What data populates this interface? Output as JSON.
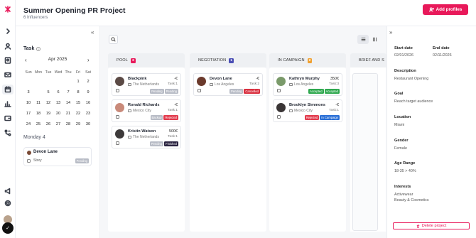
{
  "header": {
    "title": "Summer Opening PR Project",
    "subtitle": "6 Influencers",
    "add_profiles_label": "Add profiles"
  },
  "task_panel": {
    "title": "Task",
    "month_label": "Apr 2025",
    "weekdays": [
      "Sun",
      "Mon",
      "Tue",
      "Wed",
      "Thu",
      "Fri",
      "Sat"
    ],
    "weeks": [
      [
        "",
        "",
        "",
        "",
        "",
        "1",
        "2"
      ],
      [
        "3",
        "4",
        "5",
        "6",
        "7",
        "8",
        "9"
      ],
      [
        "10",
        "11",
        "12",
        "13",
        "14",
        "15",
        "16"
      ],
      [
        "17",
        "18",
        "19",
        "20",
        "21",
        "22",
        "23"
      ],
      [
        "24",
        "25",
        "26",
        "27",
        "28",
        "29",
        "30"
      ]
    ],
    "selected_day": "4",
    "day_title": "Monday 4",
    "day_task": {
      "name": "Devon Lane",
      "type": "Story",
      "status": "Pending"
    }
  },
  "board": {
    "columns": [
      {
        "title": "POOL",
        "count": "3",
        "count_color": "#e8195a",
        "cards": [
          {
            "name": "Blackpink",
            "location": "The Netherlands",
            "price": "-€",
            "task": "Task:1",
            "avatar_color": "#5b4a45",
            "badges": [
              {
                "label": "Pending",
                "color": "#b8bcc6"
              },
              {
                "label": "Pending",
                "color": "#b8bcc6"
              }
            ]
          },
          {
            "name": "Ronald Richards",
            "location": "Mexico City",
            "price": "-€",
            "task": "Task:1",
            "avatar_color": "#c98a7a",
            "badges": [
              {
                "label": "Backup",
                "color": "#b8bcc6"
              },
              {
                "label": "Rejected",
                "color": "#e23b4d"
              }
            ]
          },
          {
            "name": "Kristin Watson",
            "location": "The Netherlands",
            "price": "500€",
            "task": "Task:1",
            "avatar_color": "#3d3a3a",
            "badges": [
              {
                "label": "Pending",
                "color": "#b8bcc6"
              },
              {
                "label": "Finished",
                "color": "#2a2340"
              }
            ]
          }
        ]
      },
      {
        "title": "NEGOTIATION",
        "count": "1",
        "count_color": "#4b4fb5",
        "cards": [
          {
            "name": "Devon Lane",
            "location": "Los Angeles",
            "price": "-€",
            "task": "Task:2",
            "avatar_color": "#6b3a2c",
            "badges": [
              {
                "label": "Pending",
                "color": "#b8bcc6"
              },
              {
                "label": "Cancelled",
                "color": "#d9303f"
              }
            ]
          }
        ]
      },
      {
        "title": "IN CAMPAIGN",
        "count": "2",
        "count_color": "#f0a030",
        "cards": [
          {
            "name": "Kathryn Murphy",
            "location": "Los Angeles",
            "price": "350€",
            "task": "Task:3",
            "avatar_color": "#7a9a6a",
            "badges": [
              {
                "label": "Accepted",
                "color": "#2fa84f"
              },
              {
                "label": "Accepted",
                "color": "#2fa84f"
              }
            ]
          },
          {
            "name": "Brooklyn Simmons",
            "location": "Mexico City",
            "price": "-€",
            "task": "Task:1",
            "avatar_color": "#3a3536",
            "badges": [
              {
                "label": "Rejected",
                "color": "#e23b4d"
              },
              {
                "label": "In Campaign",
                "color": "#2a6fd6"
              }
            ]
          }
        ]
      },
      {
        "title": "BRIEF AND S",
        "count": "",
        "count_color": "#b8bcc6",
        "cards": []
      }
    ]
  },
  "details": {
    "start_date_label": "Start date",
    "start_date": "02/01/2026",
    "end_date_label": "End date",
    "end_date": "02/11/2026",
    "description_label": "Description",
    "description": "Restaurant Opening",
    "goal_label": "Goal",
    "goal": "Reach target audience",
    "location_label": "Location",
    "location": "Miami",
    "gender_label": "Gender",
    "gender": "Female",
    "age_range_label": "Age Range",
    "age_range": "18-35 > 40%",
    "interests_label": "Interests",
    "interests_1": "Activewear",
    "interests_2": "Beauty & Cosmetics",
    "delete_label": "Delete project"
  },
  "icons": {
    "rail": [
      "logo-icon",
      "chevron-right-icon",
      "user-icon",
      "contacts-icon",
      "mail-icon",
      "calendar-icon",
      "chart-icon",
      "wallet-icon",
      "flow-icon",
      "megaphone-icon",
      "settings-icon"
    ]
  },
  "colors": {
    "accent": "#e8195a"
  }
}
